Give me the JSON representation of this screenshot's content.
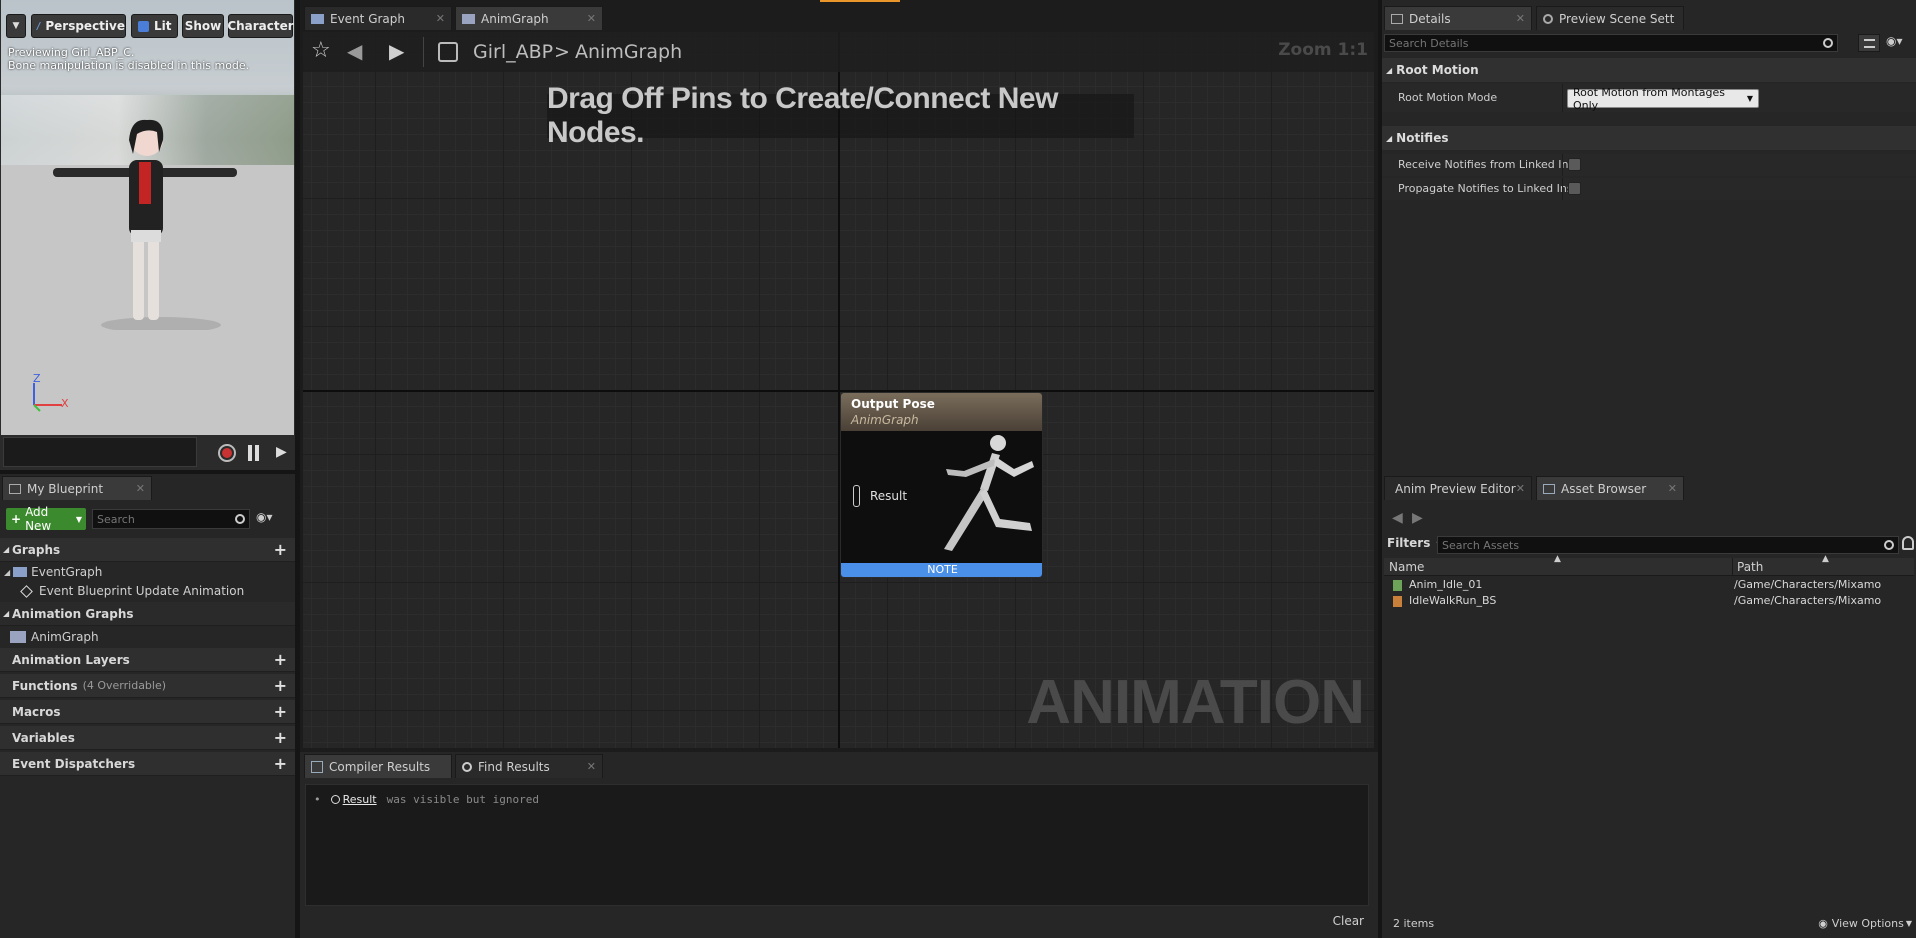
{
  "viewport": {
    "toolbar": {
      "menu_icon": "chevron-down-icon",
      "perspective": "Perspective",
      "lit": "Lit",
      "show": "Show",
      "character": "Character"
    },
    "info_line1": "Previewing Girl_ABP_C.",
    "info_line2": "Bone manipulation is disabled in this mode.",
    "axis_z": "Z",
    "axis_x": "X",
    "playback": {
      "record_icon": "record-icon",
      "pause_icon": "pause-icon",
      "step_icon": "step-forward-icon"
    }
  },
  "my_blueprint": {
    "tab_label": "My Blueprint",
    "add_new": "Add New",
    "search_placeholder": "Search",
    "sections": {
      "graphs": "Graphs",
      "event_graph": "EventGraph",
      "event_update": "Event Blueprint Update Animation",
      "animation_graphs": "Animation Graphs",
      "anim_graph": "AnimGraph",
      "animation_layers": "Animation Layers",
      "functions": "Functions",
      "functions_note": "(4 Overridable)",
      "macros": "Macros",
      "variables": "Variables",
      "event_dispatchers": "Event Dispatchers"
    }
  },
  "graph": {
    "tabs": [
      {
        "label": "Event Graph"
      },
      {
        "label": "AnimGraph"
      }
    ],
    "breadcrumb_root": "Girl_ABP",
    "breadcrumb_sep": ">",
    "breadcrumb_leaf": "AnimGraph",
    "zoom": "Zoom 1:1",
    "hint": "Drag Off Pins to Create/Connect New Nodes.",
    "watermark": "ANIMATION",
    "node": {
      "title": "Output Pose",
      "subtitle": "AnimGraph",
      "pin_label": "Result",
      "footer": "NOTE"
    }
  },
  "compiler": {
    "tabs": [
      {
        "label": "Compiler Results"
      },
      {
        "label": "Find Results"
      }
    ],
    "bullet": "•",
    "result_link": "Result",
    "result_text": "was visible but ignored",
    "clear": "Clear"
  },
  "details": {
    "tabs": [
      {
        "label": "Details"
      },
      {
        "label": "Preview Scene Sett"
      }
    ],
    "search_placeholder": "Search Details",
    "root_motion_header": "Root Motion",
    "root_motion_mode_label": "Root Motion Mode",
    "root_motion_mode_value": "Root Motion from Montages Only",
    "notifies_header": "Notifies",
    "receive_notifies": "Receive Notifies from Linked Ins",
    "propagate_notifies": "Propagate Notifies to Linked Inst"
  },
  "asset_browser": {
    "tabs": [
      {
        "label": "Anim Preview Editor"
      },
      {
        "label": "Asset Browser"
      }
    ],
    "filters": "Filters",
    "search_placeholder": "Search Assets",
    "col_name": "Name",
    "col_path": "Path",
    "rows": [
      {
        "name": "Anim_Idle_01",
        "path": "/Game/Characters/Mixamo",
        "icon_color": "#6ea35a"
      },
      {
        "name": "IdleWalkRun_BS",
        "path": "/Game/Characters/Mixamo",
        "icon_color": "#c8803a"
      }
    ],
    "count": "2 items",
    "view_options": "View Options"
  },
  "colors": {
    "accent_blue": "#4a8fe8",
    "add_green": "#3c8a2e",
    "record_red": "#c83232"
  }
}
